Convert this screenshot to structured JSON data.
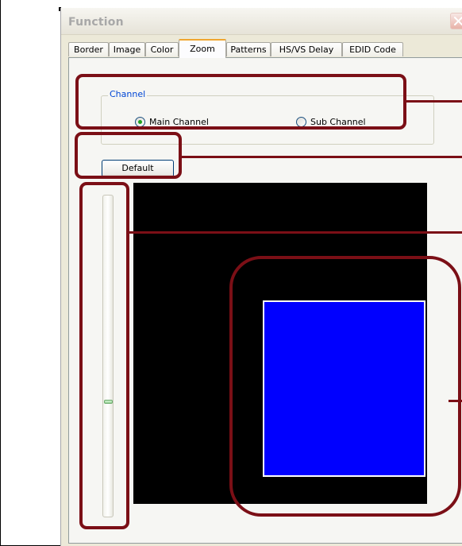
{
  "window": {
    "title": "Function",
    "close_icon": "close-icon"
  },
  "tabs": [
    {
      "label": "Border",
      "active": false
    },
    {
      "label": "Image",
      "active": false
    },
    {
      "label": "Color",
      "active": false
    },
    {
      "label": "Zoom",
      "active": true
    },
    {
      "label": "Patterns",
      "active": false
    },
    {
      "label": "HS/VS Delay",
      "active": false
    },
    {
      "label": "EDID Code",
      "active": false
    }
  ],
  "channel": {
    "group_label": "Channel",
    "main_label": "Main Channel",
    "sub_label": "Sub Channel",
    "selected": "Main Channel"
  },
  "default_button": {
    "label": "Default"
  },
  "zoom_slider": {
    "level_fraction": 0.64
  },
  "preview": {
    "background_color": "#000000",
    "window_color": "#0000ff",
    "window_border_color": "#ffffff"
  },
  "callouts": {
    "color": "#7b0f16"
  }
}
